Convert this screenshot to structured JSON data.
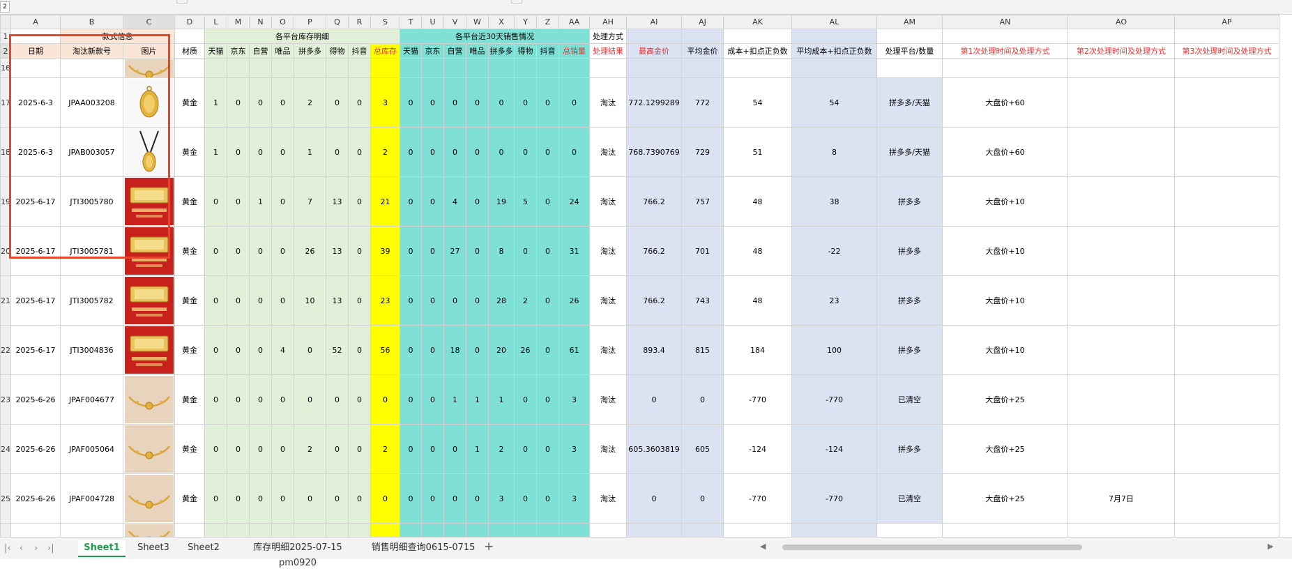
{
  "name_box": "2",
  "columns": [
    "A",
    "B",
    "C",
    "D",
    "L",
    "M",
    "N",
    "O",
    "P",
    "Q",
    "R",
    "S",
    "T",
    "U",
    "V",
    "W",
    "X",
    "Y",
    "Z",
    "AA",
    "AH",
    "AI",
    "AJ",
    "AK",
    "AL",
    "AM",
    "AN",
    "AO",
    "AP"
  ],
  "row_numbers": [
    "1",
    "2",
    "16",
    "17",
    "18",
    "19",
    "20",
    "21",
    "22",
    "23",
    "24",
    "25",
    ""
  ],
  "header_row1": {
    "style_info": "款式信息",
    "inventory_detail": "各平台库存明细",
    "sales_30d": "各平台近30天销售情况",
    "handling_method": "处理方式"
  },
  "header_row2": [
    "日期",
    "淘汰新款号",
    "图片",
    "材质",
    "天猫",
    "京东",
    "自营",
    "唯品",
    "拼多多",
    "得物",
    "抖音",
    "总库存",
    "天猫",
    "京东",
    "自营",
    "唯品",
    "拼多多",
    "得物",
    "抖音",
    "总销量",
    "处理结果",
    "最高金价",
    "平均金价",
    "成本+扣点正负数",
    "平均成本+扣点正负数",
    "处理平台/数量",
    "第1次处理时间及处理方式",
    "第2次处理时间及处理方式",
    "第3次处理时间及处理方式"
  ],
  "rows": [
    {
      "date": "2025-6-3",
      "code": "JPAA003208",
      "pic": "gold-oval-pendant",
      "material": "黄金",
      "inv": [
        "1",
        "0",
        "0",
        "0",
        "2",
        "0",
        "0"
      ],
      "inv_total": "3",
      "sales": [
        "0",
        "0",
        "0",
        "0",
        "0",
        "0",
        "0"
      ],
      "sales_total": "0",
      "result": "淘汰",
      "max_price": "772.1299289",
      "avg_price": "772",
      "cost": "54",
      "avg_cost": "54",
      "platform": "拼多多/天猫",
      "first": "大盘价+60",
      "second": "",
      "third": ""
    },
    {
      "date": "2025-6-3",
      "code": "JPAB003057",
      "pic": "gold-necklace-pendant",
      "material": "黄金",
      "inv": [
        "1",
        "0",
        "0",
        "0",
        "1",
        "0",
        "0"
      ],
      "inv_total": "2",
      "sales": [
        "0",
        "0",
        "0",
        "0",
        "0",
        "0",
        "0"
      ],
      "sales_total": "0",
      "result": "淘汰",
      "max_price": "768.7390769",
      "avg_price": "729",
      "cost": "51",
      "avg_cost": "8",
      "platform": "拼多多/天猫",
      "first": "大盘价+60",
      "second": "",
      "third": ""
    },
    {
      "date": "2025-6-17",
      "code": "JTI3005780",
      "pic": "red-gold-bar",
      "material": "黄金",
      "inv": [
        "0",
        "0",
        "1",
        "0",
        "7",
        "13",
        "0"
      ],
      "inv_total": "21",
      "sales": [
        "0",
        "0",
        "4",
        "0",
        "19",
        "5",
        "0"
      ],
      "sales_total": "24",
      "result": "淘汰",
      "max_price": "766.2",
      "avg_price": "757",
      "cost": "48",
      "avg_cost": "38",
      "platform": "拼多多",
      "first": "大盘价+10",
      "second": "",
      "third": ""
    },
    {
      "date": "2025-6-17",
      "code": "JTI3005781",
      "pic": "red-gold-bar",
      "material": "黄金",
      "inv": [
        "0",
        "0",
        "0",
        "0",
        "26",
        "13",
        "0"
      ],
      "inv_total": "39",
      "sales": [
        "0",
        "0",
        "27",
        "0",
        "8",
        "0",
        "0"
      ],
      "sales_total": "31",
      "result": "淘汰",
      "max_price": "766.2",
      "avg_price": "701",
      "cost": "48",
      "avg_cost": "-22",
      "platform": "拼多多",
      "first": "大盘价+10",
      "second": "",
      "third": ""
    },
    {
      "date": "2025-6-17",
      "code": "JTI3005782",
      "pic": "red-gold-bar",
      "material": "黄金",
      "inv": [
        "0",
        "0",
        "0",
        "0",
        "10",
        "13",
        "0"
      ],
      "inv_total": "23",
      "sales": [
        "0",
        "0",
        "0",
        "0",
        "28",
        "2",
        "0"
      ],
      "sales_total": "26",
      "result": "淘汰",
      "max_price": "766.2",
      "avg_price": "743",
      "cost": "48",
      "avg_cost": "23",
      "platform": "拼多多",
      "first": "大盘价+10",
      "second": "",
      "third": ""
    },
    {
      "date": "2025-6-17",
      "code": "JTI3004836",
      "pic": "red-gold-bar",
      "material": "黄金",
      "inv": [
        "0",
        "0",
        "0",
        "4",
        "0",
        "52",
        "0"
      ],
      "inv_total": "56",
      "sales": [
        "0",
        "0",
        "18",
        "0",
        "20",
        "26",
        "0"
      ],
      "sales_total": "61",
      "result": "淘汰",
      "max_price": "893.4",
      "avg_price": "815",
      "cost": "184",
      "avg_cost": "100",
      "platform": "拼多多",
      "first": "大盘价+10",
      "second": "",
      "third": ""
    },
    {
      "date": "2025-6-26",
      "code": "JPAF004677",
      "pic": "gold-bracelet",
      "material": "黄金",
      "inv": [
        "0",
        "0",
        "0",
        "0",
        "0",
        "0",
        "0"
      ],
      "inv_total": "0",
      "sales": [
        "0",
        "0",
        "1",
        "1",
        "1",
        "0",
        "0"
      ],
      "sales_total": "3",
      "result": "淘汰",
      "max_price": "0",
      "avg_price": "0",
      "cost": "-770",
      "avg_cost": "-770",
      "platform": "已清空",
      "first": "大盘价+25",
      "second": "",
      "third": ""
    },
    {
      "date": "2025-6-26",
      "code": "JPAF005064",
      "pic": "gold-bracelet",
      "material": "黄金",
      "inv": [
        "0",
        "0",
        "0",
        "0",
        "2",
        "0",
        "0"
      ],
      "inv_total": "2",
      "sales": [
        "0",
        "0",
        "0",
        "1",
        "2",
        "0",
        "0"
      ],
      "sales_total": "3",
      "result": "淘汰",
      "max_price": "605.3603819",
      "avg_price": "605",
      "cost": "-124",
      "avg_cost": "-124",
      "platform": "拼多多",
      "first": "大盘价+25",
      "second": "",
      "third": ""
    },
    {
      "date": "2025-6-26",
      "code": "JPAF004728",
      "pic": "gold-bracelet",
      "material": "黄金",
      "inv": [
        "0",
        "0",
        "0",
        "0",
        "0",
        "0",
        "0"
      ],
      "inv_total": "0",
      "sales": [
        "0",
        "0",
        "0",
        "0",
        "3",
        "0",
        "0"
      ],
      "sales_total": "3",
      "result": "淘汰",
      "max_price": "0",
      "avg_price": "0",
      "cost": "-770",
      "avg_cost": "-770",
      "platform": "已清空",
      "first": "大盘价+25",
      "second": "7月7日",
      "third": ""
    }
  ],
  "tabs": [
    "Sheet1",
    "Sheet3",
    "Sheet2",
    "库存明细2025-07-15 pm0920",
    "销售明细查询0615-0715"
  ],
  "active_tab": "Sheet1",
  "colors": {
    "peach": "#fbe5d6",
    "green": "#e2f0d9",
    "teal": "#7fe0d5",
    "yellow": "#ffff00",
    "blue": "#dbe3f3",
    "red_text": "#e83030",
    "selection": "#e8462a",
    "active_tab": "#1d9b4a"
  }
}
